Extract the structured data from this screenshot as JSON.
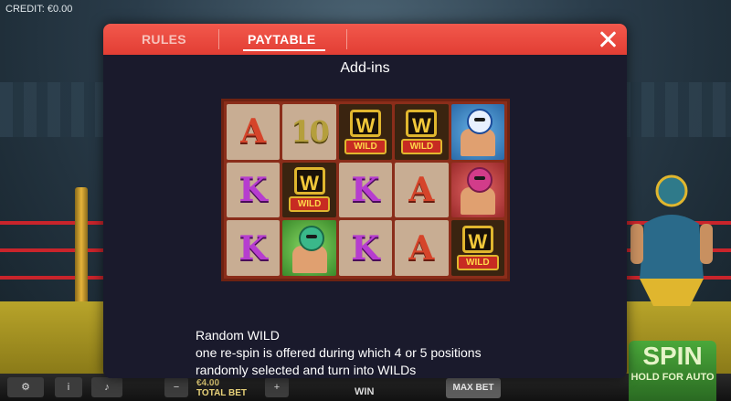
{
  "credit": "CREDIT: €0.00",
  "modal": {
    "tabs": [
      {
        "label": "RULES",
        "active": false
      },
      {
        "label": "PAYTABLE",
        "active": true
      }
    ],
    "close_icon": "close-icon",
    "section_title": "Add-ins",
    "reels": {
      "rows": [
        [
          "A",
          "10",
          "WILD",
          "WILD",
          "hero-blue"
        ],
        [
          "K",
          "WILD",
          "K",
          "A",
          "hero-pink"
        ],
        [
          "K",
          "hero-green",
          "K",
          "A",
          "WILD"
        ]
      ],
      "wild_letter": "W",
      "wild_label": "WILD"
    },
    "description": {
      "heading": "Random WILD",
      "line1": "one re-spin is offered during which 4 or 5 positions",
      "line2": "randomly selected and turn into WILDs"
    }
  },
  "bottom_bar": {
    "total_bet_value": "€4.00",
    "total_bet_label": "TOTAL BET",
    "win_label": "WIN",
    "max_bet_label": "MAX BET"
  },
  "spin": {
    "label": "SPIN",
    "sublabel": "HOLD FOR AUTO"
  },
  "colors": {
    "header_red": "#e23e34",
    "modal_bg": "#1a1a2c",
    "spin_green": "#4aa83a"
  }
}
